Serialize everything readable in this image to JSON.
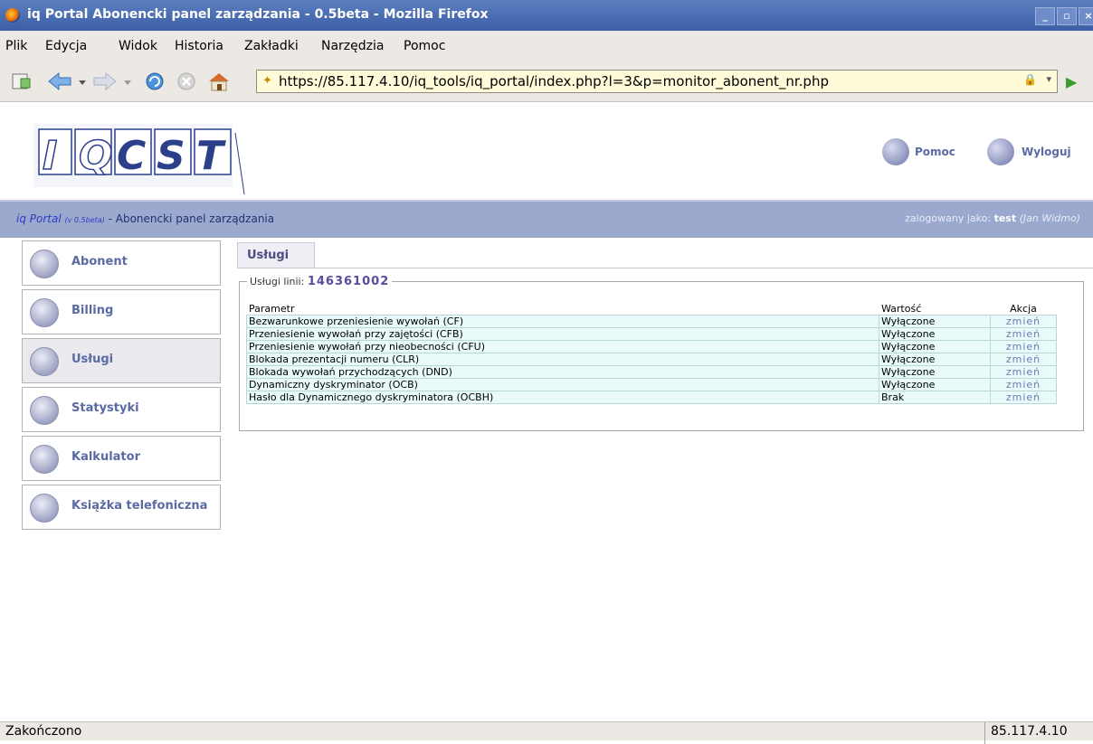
{
  "window": {
    "title": "iq Portal Abonencki panel zarządzania - 0.5beta - Mozilla Firefox",
    "controls": [
      "_",
      "▫",
      "×"
    ]
  },
  "menu": {
    "items": [
      {
        "label": "Plik",
        "key": "P"
      },
      {
        "label": "Edycja",
        "key": "E"
      },
      {
        "label": "Widok",
        "key": "W"
      },
      {
        "label": "Historia",
        "key": "H"
      },
      {
        "label": "Zakładki",
        "key": "Z"
      },
      {
        "label": "Narzędzia",
        "key": "N"
      },
      {
        "label": "Pomoc",
        "key": "c"
      }
    ]
  },
  "navbar": {
    "url": "https://85.117.4.10/iq_tools/iq_portal/index.php?l=3&p=monitor_abonent_nr.php",
    "icons": [
      "new-tab-icon",
      "back-icon",
      "forward-icon",
      "reload-icon",
      "stop-icon",
      "home-icon",
      "go-icon"
    ]
  },
  "header": {
    "logo_text": "IQCST",
    "help_label": "Pomoc",
    "logout_label": "Wyloguj"
  },
  "infobar": {
    "portal_name": "iq Portal",
    "version": "(v 0.5beta)",
    "subtitle": " - Abonencki panel zarządzania",
    "logged_prefix": "zalogowany jako: ",
    "user": "test",
    "user_name": "(Jan Widmo)"
  },
  "sidebar": {
    "items": [
      {
        "label": "Abonent",
        "icon": "phone-icon"
      },
      {
        "label": "Billing",
        "icon": "document-icon"
      },
      {
        "label": "Usługi",
        "icon": "gear-icon",
        "active": true
      },
      {
        "label": "Statystyki",
        "icon": "gear-icon"
      },
      {
        "label": "Kalkulator",
        "icon": "gear-icon"
      },
      {
        "label": "Książka telefoniczna",
        "icon": "gear-icon"
      }
    ]
  },
  "main": {
    "tab_label": "Usługi",
    "box_label": "Usługi linii: ",
    "line_number": "146361002",
    "columns": [
      "Parametr",
      "Wartość",
      "Akcja"
    ],
    "rows": [
      {
        "param": "Bezwarunkowe przeniesienie wywołań (CF)",
        "value": "Wyłączone",
        "action": "zmień"
      },
      {
        "param": "Przeniesienie wywołań przy zajętości (CFB)",
        "value": "Wyłączone",
        "action": "zmień"
      },
      {
        "param": "Przeniesienie wywołań przy nieobecności (CFU)",
        "value": "Wyłączone",
        "action": "zmień"
      },
      {
        "param": "Blokada prezentacji numeru (CLR)",
        "value": "Wyłączone",
        "action": "zmień"
      },
      {
        "param": "Blokada wywołań przychodzących (DND)",
        "value": "Wyłączone",
        "action": "zmień"
      },
      {
        "param": "Dynamiczny dyskryminator (OCB)",
        "value": "Wyłączone",
        "action": "zmień"
      },
      {
        "param": "Hasło dla Dynamicznego dyskryminatora (OCBH)",
        "value": "Brak",
        "action": "zmień"
      }
    ]
  },
  "status": {
    "text": "Zakończono",
    "host": "85.117.4.10"
  }
}
